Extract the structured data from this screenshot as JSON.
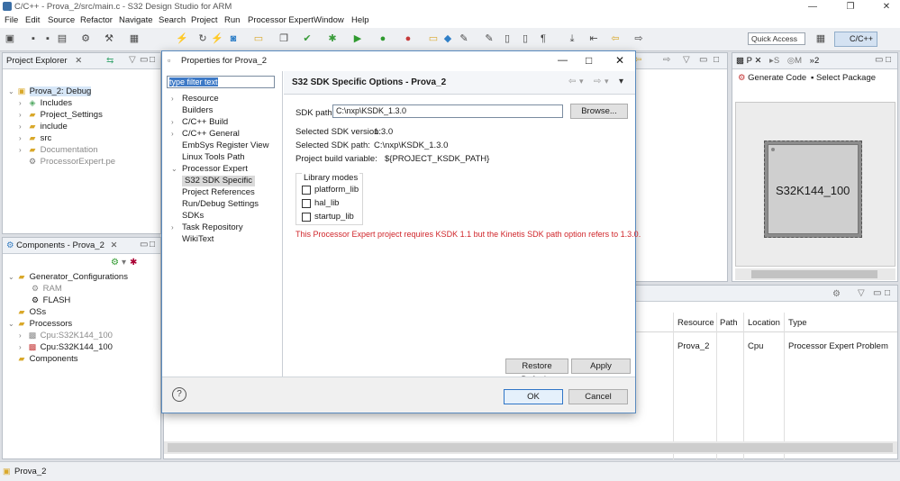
{
  "window": {
    "title": "C/C++ - Prova_2/src/main.c - S32 Design Studio for ARM",
    "minimize": "—",
    "restore": "❐",
    "close": "✕"
  },
  "menu": [
    "File",
    "Edit",
    "Source",
    "Refactor",
    "Navigate",
    "Search",
    "Project",
    "Run",
    "Processor Expert",
    "Window",
    "Help"
  ],
  "toolbar": {
    "quick_access": "Quick Access",
    "perspective": "C/C++"
  },
  "project_explorer": {
    "tab": "Project Explorer",
    "items": [
      {
        "label": "Prova_2: Debug",
        "level": 0,
        "expanded": true,
        "selected": true,
        "icon": "project-icon"
      },
      {
        "label": "Includes",
        "level": 1,
        "icon": "includes-icon"
      },
      {
        "label": "Project_Settings",
        "level": 1,
        "icon": "folder-icon"
      },
      {
        "label": "include",
        "level": 1,
        "icon": "folder-icon"
      },
      {
        "label": "src",
        "level": 1,
        "icon": "folder-icon"
      },
      {
        "label": "Documentation",
        "level": 1,
        "icon": "folder-icon",
        "grey": true
      },
      {
        "label": "ProcessorExpert.pe",
        "level": 1,
        "icon": "pe-file-icon",
        "grey": true
      }
    ]
  },
  "components": {
    "tab": "Components - Prova_2",
    "items": [
      {
        "label": "Generator_Configurations",
        "level": 0,
        "icon": "folder-icon"
      },
      {
        "label": "RAM",
        "level": 1,
        "icon": "gear-icon",
        "grey": true
      },
      {
        "label": "FLASH",
        "level": 1,
        "icon": "gear-icon"
      },
      {
        "label": "OSs",
        "level": 0,
        "icon": "folder-icon"
      },
      {
        "label": "Processors",
        "level": 0,
        "icon": "folder-icon"
      },
      {
        "label": "Cpu:S32K144_100",
        "level": 1,
        "icon": "cpu-icon",
        "grey": true
      },
      {
        "label": "Cpu:S32K144_100",
        "level": 1,
        "icon": "cpu-icon"
      },
      {
        "label": "Components",
        "level": 0,
        "icon": "folder-icon"
      }
    ]
  },
  "processor_view": {
    "tab1": "P",
    "tab2": "S",
    "tab3": "M",
    "tab_overflow": "»2",
    "generate_code": "Generate Code",
    "select_package": "Select Package",
    "chip_label": "S32K144_100"
  },
  "problems": {
    "columns": [
      "Resource",
      "Path",
      "Location",
      "Type"
    ],
    "row": {
      "resource": "Prova_2",
      "path": "",
      "location": "Cpu",
      "type": "Processor Expert Problem"
    }
  },
  "status_bar": {
    "text": "Prova_2"
  },
  "dialog": {
    "title": "Properties for Prova_2",
    "filter": "type filter text",
    "nav": [
      {
        "label": "Resource",
        "twisty": ">",
        "indent": 0
      },
      {
        "label": "Builders",
        "twisty": "",
        "indent": 0
      },
      {
        "label": "C/C++ Build",
        "twisty": ">",
        "indent": 0
      },
      {
        "label": "C/C++ General",
        "twisty": ">",
        "indent": 0
      },
      {
        "label": "EmbSys Register View",
        "twisty": "",
        "indent": 0
      },
      {
        "label": "Linux Tools Path",
        "twisty": "",
        "indent": 0
      },
      {
        "label": "Processor Expert",
        "twisty": "v",
        "indent": 0
      },
      {
        "label": "S32 SDK Specific",
        "twisty": "",
        "indent": 1,
        "selected": true
      },
      {
        "label": "Project References",
        "twisty": "",
        "indent": 0
      },
      {
        "label": "Run/Debug Settings",
        "twisty": "",
        "indent": 0
      },
      {
        "label": "SDKs",
        "twisty": "",
        "indent": 0
      },
      {
        "label": "Task Repository",
        "twisty": ">",
        "indent": 0
      },
      {
        "label": "WikiText",
        "twisty": "",
        "indent": 0
      }
    ],
    "page_title": "S32 SDK Specific Options - Prova_2",
    "sdk_path_label": "SDK path",
    "sdk_path_value": "C:\\nxp\\KSDK_1.3.0",
    "browse": "Browse...",
    "info": [
      {
        "label": "Selected SDK version:",
        "value": "1.3.0"
      },
      {
        "label": "Selected SDK path:",
        "value": "C:\\nxp\\KSDK_1.3.0"
      },
      {
        "label": "Project build variable:",
        "value": "${PROJECT_KSDK_PATH}"
      }
    ],
    "library_modes_label": "Library modes",
    "library_modes": [
      {
        "label": "platform_lib",
        "checked": false
      },
      {
        "label": "hal_lib",
        "checked": false
      },
      {
        "label": "startup_lib",
        "checked": false
      }
    ],
    "error": "This Processor Expert project requires KSDK 1.1 but the Kinetis SDK path option refers to 1.3.0.",
    "restore_defaults": "Restore Defaults",
    "apply": "Apply",
    "ok": "OK",
    "cancel": "Cancel",
    "help": "?",
    "error_color": "#d0262b"
  }
}
